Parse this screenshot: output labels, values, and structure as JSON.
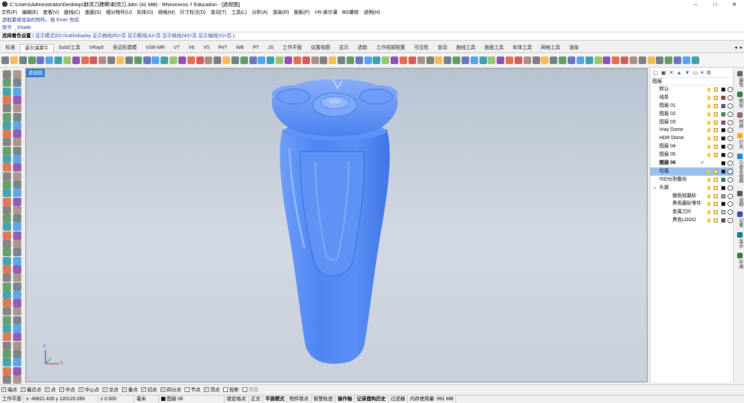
{
  "window": {
    "title": "C:\\Users\\Administrator\\Desktop\\剃须刀建模\\剃须刀.3dm (41 MB) - Rhinoceros 7 Education - [透视图]",
    "minimize": "–",
    "maximize": "□",
    "close": "✕"
  },
  "menu": [
    "文件(F)",
    "编辑(E)",
    "查看(V)",
    "曲线(C)",
    "曲面(S)",
    "细分物件(U)",
    "实体(O)",
    "网格(M)",
    "尺寸标注(D)",
    "变动(T)",
    "工具(L)",
    "分析(A)",
    "渲染(R)",
    "面板(P)",
    "VR-桌尔课",
    "BG螺栓",
    "说明(H)"
  ],
  "command": {
    "history1": "选取要被渲染的物件。按 Enter 完成",
    "history2": "指令: _Shade",
    "prompt_label": "选择着色设置",
    "prompt_options": "( 显示模式(D)=SubDdisplay  显示曲线(R)=否  显示框线(A)=否  显示格线(W)=否  显示轴线(X)=否 ):"
  },
  "tabs": [
    "标准",
    "桌尔课犀牛",
    "SubD工具",
    "VRay5",
    "多边形建模",
    "VSR-MR",
    "V7",
    "V6",
    "V5",
    "PeT",
    "WB",
    "PT",
    "JS",
    "工作平面",
    "设置视图",
    "显示",
    "选取",
    "工作视窗配置",
    "可见性",
    "变动",
    "曲线工具",
    "曲面工具",
    "实体工具",
    "网格工具",
    "渲染"
  ],
  "active_tab": "桌尔课犀牛",
  "viewport": {
    "label": "透视图",
    "axis_x": "x",
    "axis_y": "y",
    "axis_z": "z",
    "model_color": "#4f86f2"
  },
  "layers_panel": {
    "title": "图层",
    "rows": [
      {
        "name": "默认",
        "color": "#000000",
        "indent": 0
      },
      {
        "name": "线条",
        "color": "#e02020",
        "indent": 0
      },
      {
        "name": "图层 01",
        "color": "#1f5fe8",
        "indent": 0
      },
      {
        "name": "图层 02",
        "color": "#22b022",
        "indent": 0
      },
      {
        "name": "图层 03",
        "color": "#d81b8a",
        "indent": 0
      },
      {
        "name": "Vray Dome",
        "color": "#000000",
        "indent": 0
      },
      {
        "name": "HDR Dome",
        "color": "#000000",
        "indent": 0
      },
      {
        "name": "图层 04",
        "color": "#000000",
        "indent": 0
      },
      {
        "name": "图层 05",
        "color": "#000000",
        "indent": 0
      },
      {
        "name": "图层 06",
        "color": "#000000",
        "indent": 0,
        "current": true
      },
      {
        "name": "垃圾",
        "color": "#000000",
        "indent": 0,
        "selected": true
      },
      {
        "name": "ISO分割备份",
        "color": "#1a8a1a",
        "indent": 0
      },
      {
        "name": "头部",
        "color": "#000000",
        "indent": 0,
        "expander": "⌄"
      },
      {
        "name": "银色轻磨砂",
        "color": "#999999",
        "indent": 1
      },
      {
        "name": "黑色磨砂零件",
        "color": "#000000",
        "indent": 1
      },
      {
        "name": "金属刀片",
        "color": "#cfcfcf",
        "indent": 1
      },
      {
        "name": "黑色LOGO",
        "color": "#7a2a5a",
        "indent": 1
      }
    ],
    "checkmark": "✓"
  },
  "side_tabs": [
    "属性",
    "图层",
    "材质",
    "灯光",
    "已命名视图",
    "说明",
    "记录",
    "显示",
    "环境"
  ],
  "osnaps": [
    {
      "label": "端点",
      "checked": true
    },
    {
      "label": "最近点",
      "checked": true
    },
    {
      "label": "点",
      "checked": true
    },
    {
      "label": "中点",
      "checked": true
    },
    {
      "label": "中心点",
      "checked": true
    },
    {
      "label": "交点",
      "checked": true
    },
    {
      "label": "垂点",
      "checked": true
    },
    {
      "label": "切点",
      "checked": true
    },
    {
      "label": "四分点",
      "checked": true
    },
    {
      "label": "节点",
      "checked": false
    },
    {
      "label": "顶点",
      "checked": true
    },
    {
      "label": "投影",
      "checked": false
    },
    {
      "label": "停用",
      "checked": false,
      "disabled": true
    }
  ],
  "status": {
    "cplane": "工作平面",
    "coords": "x -49821.426 y 120120.050",
    "z": "z 0.000",
    "units": "毫米",
    "layer": "图层 06",
    "items": [
      "锁定格点",
      "正交",
      "平面模式",
      "物件锁点",
      "智慧轨迹",
      "操作轴",
      "记录建构历史",
      "过滤器",
      "内存使用量: 991 MB"
    ],
    "bold_items": [
      "平面模式",
      "操作轴",
      "记录建构历史"
    ]
  }
}
